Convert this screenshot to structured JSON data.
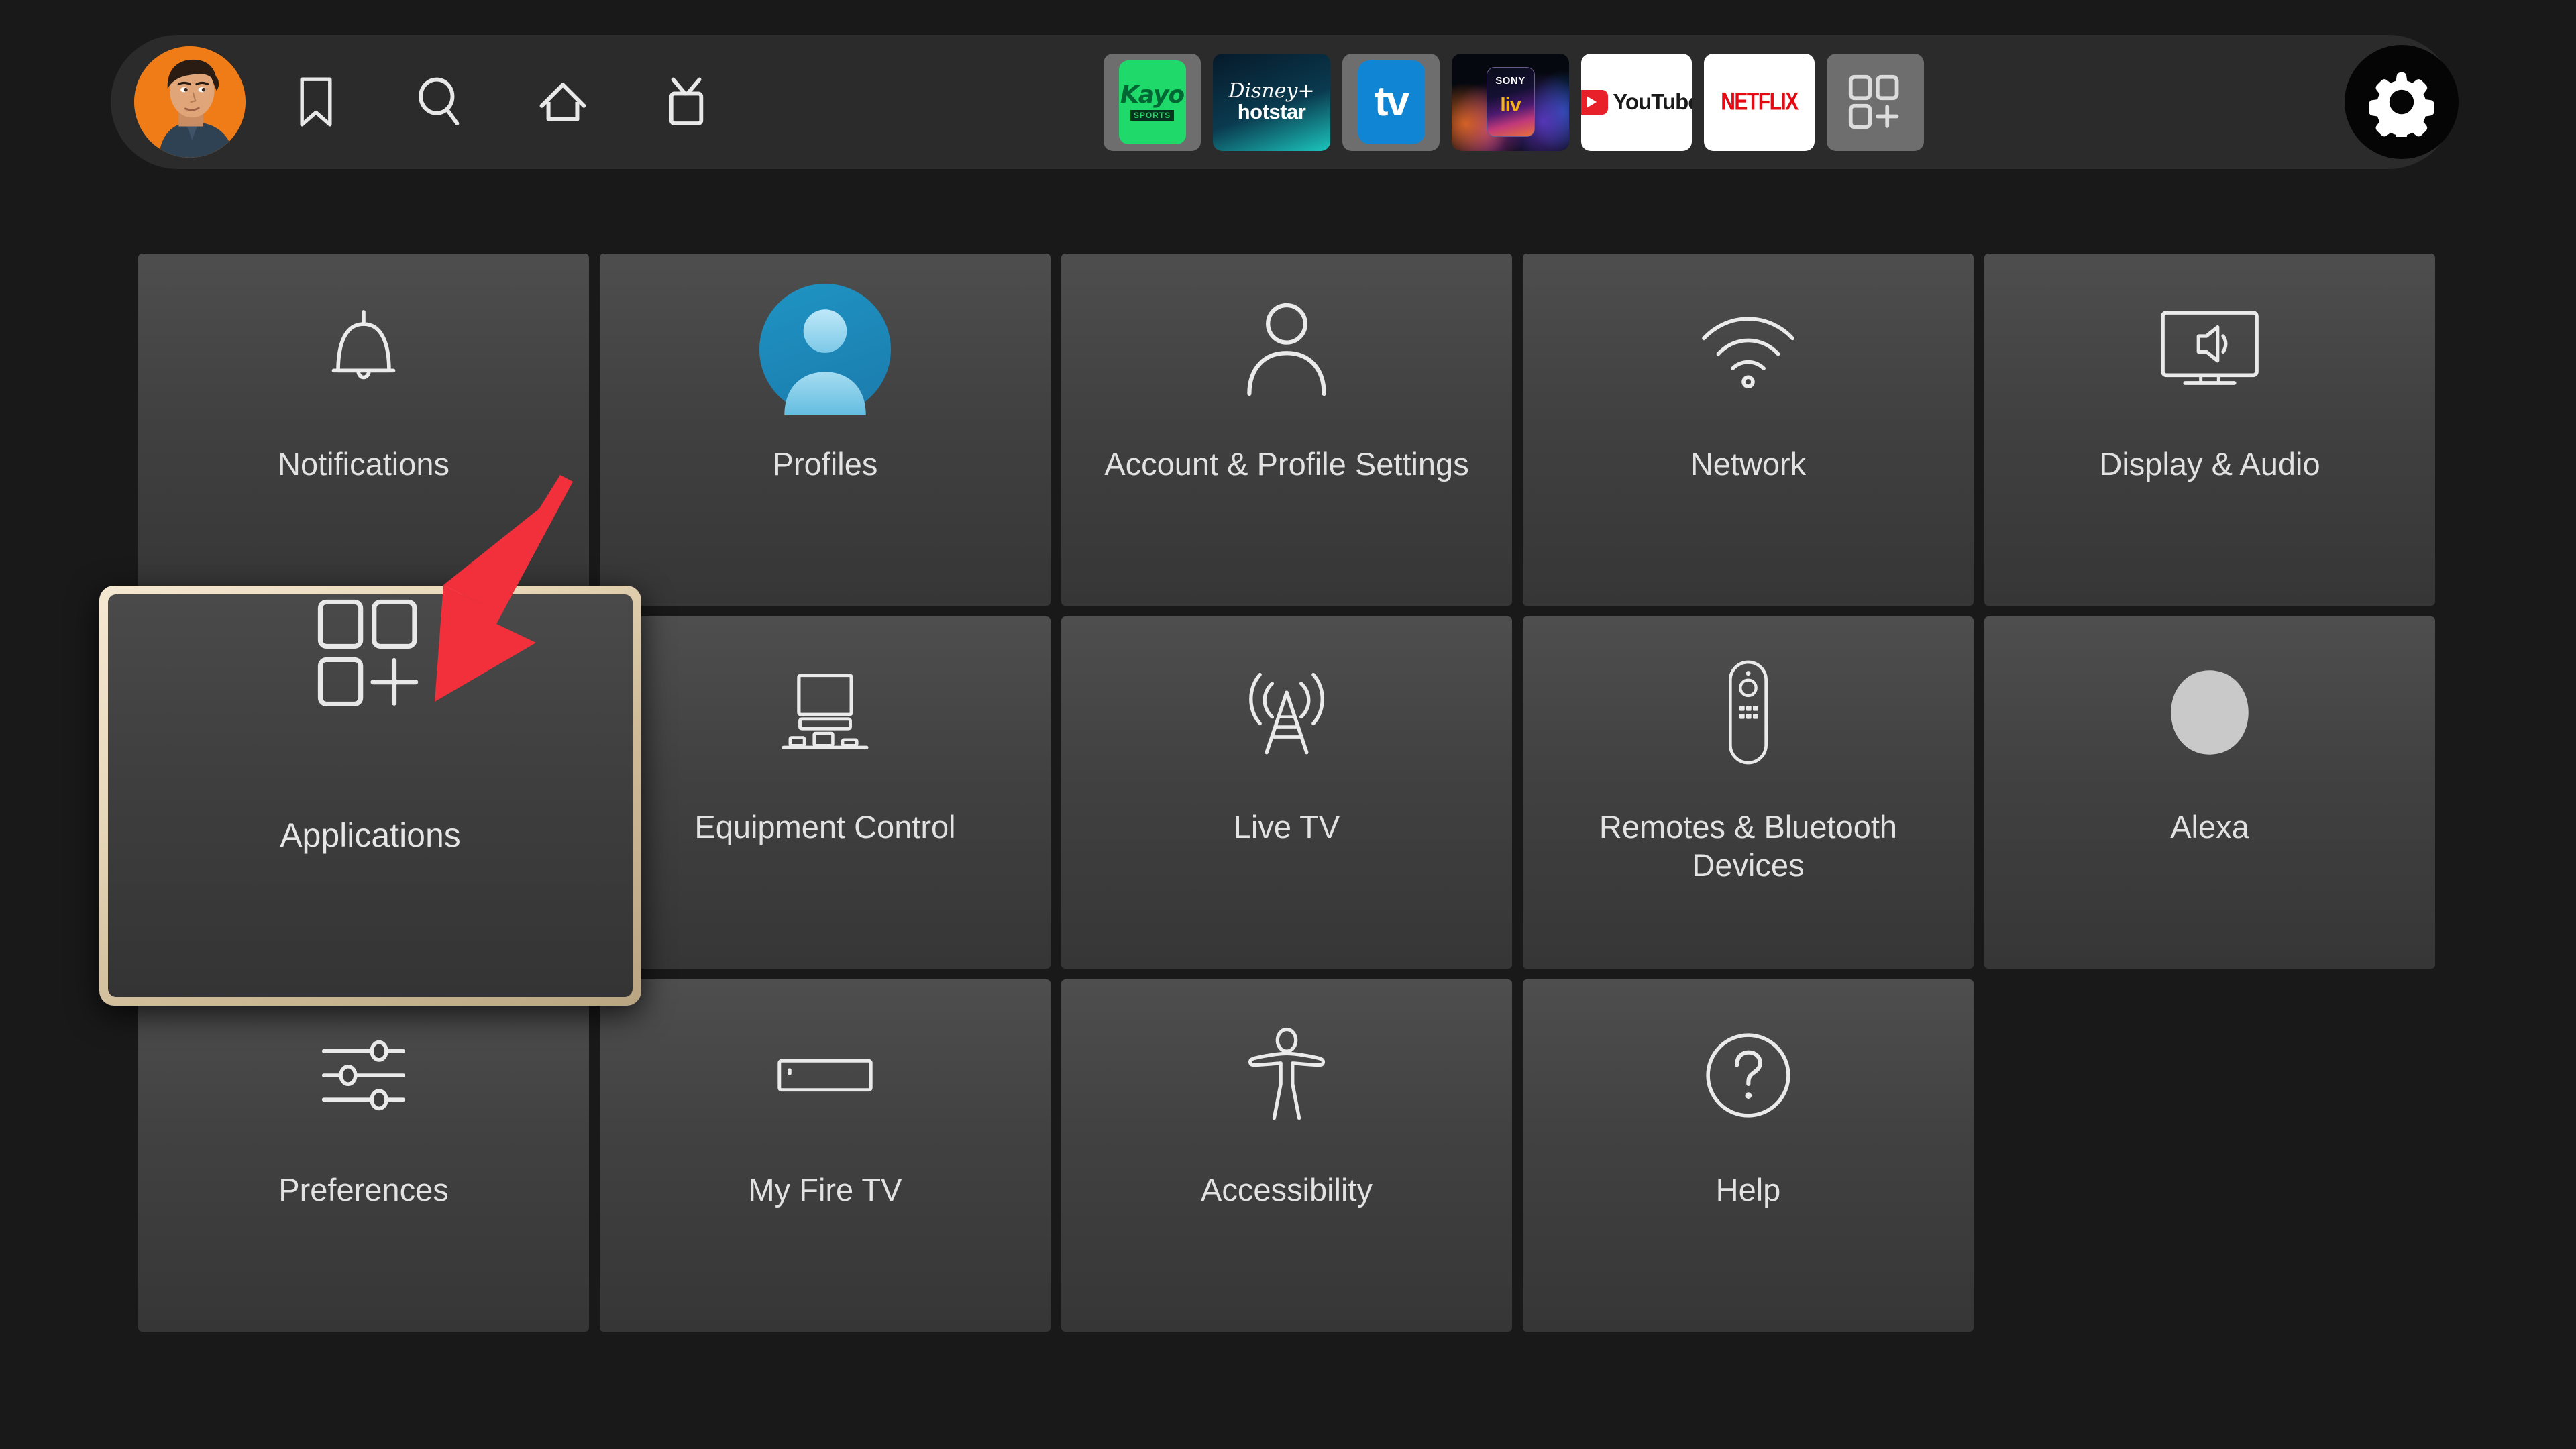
{
  "topbar": {
    "avatar": {
      "name": "user-avatar",
      "alt": "Profile picture",
      "bg_color": "#f07c18"
    },
    "nav_icons": [
      {
        "name": "bookmark-icon",
        "label": "Watchlist"
      },
      {
        "name": "search-icon",
        "label": "Search"
      },
      {
        "name": "home-icon",
        "label": "Home"
      },
      {
        "name": "live-tv-icon",
        "label": "Live"
      }
    ],
    "apps": [
      {
        "name": "kayo-sports-app",
        "label": "Kayo",
        "sublabel": "SPORTS",
        "bg": "#1fd96b"
      },
      {
        "name": "disney-hotstar-app",
        "label": "hotstar",
        "brand": "Disney+",
        "bg": "#0a3a4f"
      },
      {
        "name": "tubi-tv-app",
        "label": "tv",
        "bg": "#1085d4"
      },
      {
        "name": "sony-liv-app",
        "label": "liv",
        "brand": "SONY",
        "bg": "#06080f"
      },
      {
        "name": "youtube-app",
        "label": "YouTube",
        "bg": "#ffffff",
        "accent": "#e8202a"
      },
      {
        "name": "netflix-app",
        "label": "NETFLIX",
        "bg": "#ffffff",
        "accent": "#e50914"
      },
      {
        "name": "all-apps-button",
        "label": "",
        "bg": "#6e6e6e"
      }
    ],
    "settings_button": {
      "name": "settings-gear-button",
      "label": "Settings",
      "selected": true
    }
  },
  "settings_grid": {
    "focused_item": "Applications",
    "focus_border_color": "#e9d9bc",
    "rows": [
      [
        {
          "id": "notifications",
          "label": "Notifications",
          "icon": "bell-icon"
        },
        {
          "id": "profiles",
          "label": "Profiles",
          "icon": "profile-avatar-icon"
        },
        {
          "id": "account-settings",
          "label": "Account & Profile Settings",
          "icon": "person-icon"
        },
        {
          "id": "network",
          "label": "Network",
          "icon": "wifi-icon"
        },
        {
          "id": "display-audio",
          "label": "Display & Audio",
          "icon": "tv-speaker-icon"
        }
      ],
      [
        {
          "id": "applications",
          "label": "Applications",
          "icon": "apps-grid-plus-icon",
          "focused": true
        },
        {
          "id": "equipment-control",
          "label": "Equipment Control",
          "icon": "tv-equipment-icon"
        },
        {
          "id": "live-tv",
          "label": "Live TV",
          "icon": "broadcast-tower-icon"
        },
        {
          "id": "remotes-bluetooth",
          "label": "Remotes & Bluetooth Devices",
          "icon": "remote-control-icon"
        },
        {
          "id": "alexa",
          "label": "Alexa",
          "icon": "alexa-ring-icon"
        }
      ],
      [
        {
          "id": "preferences",
          "label": "Preferences",
          "icon": "sliders-icon"
        },
        {
          "id": "my-fire-tv",
          "label": "My Fire TV",
          "icon": "fire-tv-stick-icon"
        },
        {
          "id": "accessibility",
          "label": "Accessibility",
          "icon": "accessibility-person-icon"
        },
        {
          "id": "help",
          "label": "Help",
          "icon": "question-mark-circle-icon"
        }
      ]
    ]
  },
  "annotation": {
    "arrow": {
      "name": "pointer-arrow",
      "color": "#f2303c",
      "points_to": "Applications"
    }
  }
}
